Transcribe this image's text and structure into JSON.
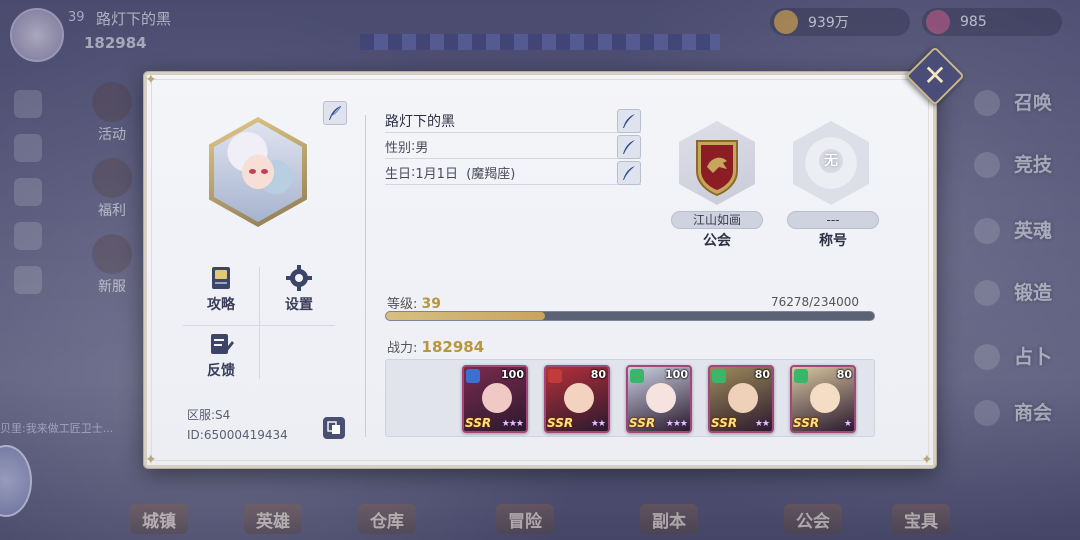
{
  "background": {
    "player": {
      "level": "39",
      "name": "路灯下的黑",
      "power": "182984"
    },
    "resources": [
      {
        "value": "939万"
      },
      {
        "value": "985"
      }
    ],
    "left_menu": [
      {
        "label": "活动"
      },
      {
        "label": "福利"
      },
      {
        "label": "新服"
      }
    ],
    "chat_snippet": "贝里:我来做工匠卫士...",
    "right_menu": [
      {
        "label": "召唤"
      },
      {
        "label": "竞技"
      },
      {
        "label": "英魂"
      },
      {
        "label": "锻造"
      },
      {
        "label": "占卜"
      },
      {
        "label": "商会"
      }
    ],
    "bottom_nav": [
      {
        "label": "城镇"
      },
      {
        "label": "英雄"
      },
      {
        "label": "仓库"
      },
      {
        "label": "冒险"
      },
      {
        "label": "副本"
      },
      {
        "label": "公会"
      },
      {
        "label": "宝具"
      }
    ]
  },
  "profile": {
    "name": "路灯下的黑",
    "gender_label": "性别",
    "gender": "男",
    "birthday_label": "生日",
    "birthday": "1月1日",
    "zodiac": "(魔羯座)",
    "guild_name": "江山如画",
    "guild_label": "公会",
    "title_value": "---",
    "title_label": "称号",
    "title_emblem_text": "无",
    "level_label": "等级:",
    "level": "39",
    "exp_current": "76278",
    "exp_max": "234000",
    "exp_text": "76278/234000",
    "exp_fraction": 0.326,
    "power_label": "战力:",
    "power": "182984",
    "server": "区服:S4",
    "id": "ID:65000419434"
  },
  "functions": {
    "guide": "攻略",
    "settings": "设置",
    "feedback": "反馈"
  },
  "team": [
    {
      "level": "100",
      "rank": "SSR",
      "element": "water",
      "element_color": "#3d6fd1",
      "frame_color": "#a3477a",
      "bg": "#7a2a4f",
      "face": "#f0c8c4",
      "stars": "★★★"
    },
    {
      "level": "80",
      "rank": "SSR",
      "element": "fire",
      "element_color": "#c23b3b",
      "frame_color": "#a3477a",
      "bg": "#b3303a",
      "face": "#f3d2bf",
      "stars": "★★"
    },
    {
      "level": "100",
      "rank": "SSR",
      "element": "wind",
      "element_color": "#3bb56a",
      "frame_color": "#a3477a",
      "bg": "#c9cfe0",
      "face": "#f6e2de",
      "stars": "★★★"
    },
    {
      "level": "80",
      "rank": "SSR",
      "element": "wind",
      "element_color": "#3bb56a",
      "frame_color": "#a3477a",
      "bg": "#9e8a5a",
      "face": "#efd0b8",
      "stars": "★★"
    },
    {
      "level": "80",
      "rank": "SSR",
      "element": "wind",
      "element_color": "#3bb56a",
      "frame_color": "#a3477a",
      "bg": "#d8c7a0",
      "face": "#f4dcc5",
      "stars": "★"
    }
  ],
  "colors": {
    "gold": "#b8963e",
    "exp_fill": "#d8bf80",
    "close_btn": "#4a4d78"
  }
}
